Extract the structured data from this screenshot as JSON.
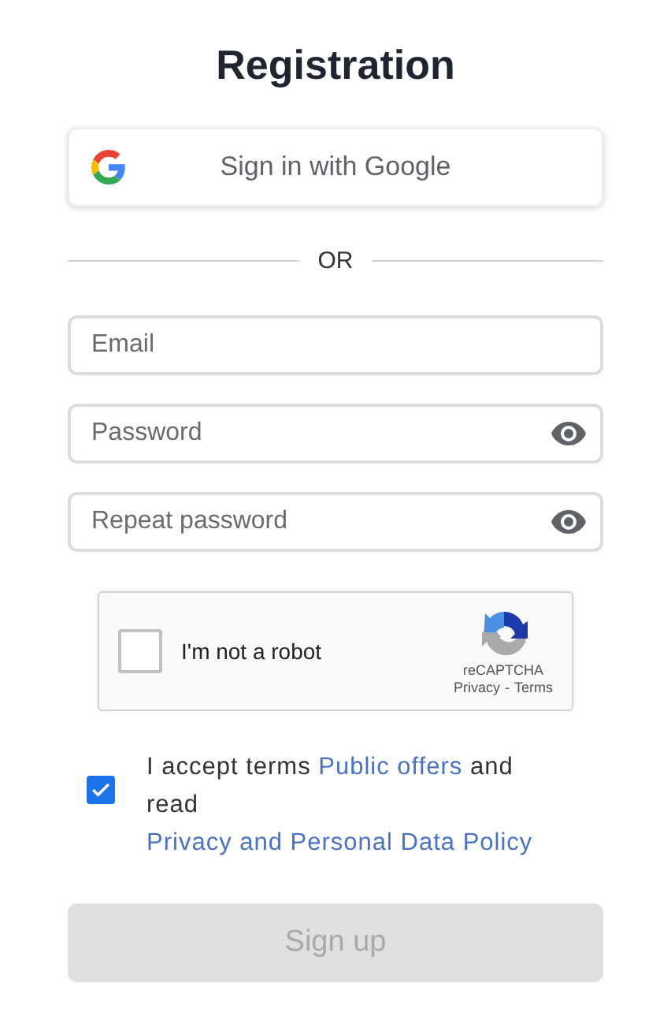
{
  "title": "Registration",
  "google_button": {
    "label": "Sign in with Google"
  },
  "divider": "OR",
  "fields": [
    {
      "placeholder": "Email",
      "kind": "text"
    },
    {
      "placeholder": "Password",
      "kind": "password"
    },
    {
      "placeholder": "Repeat password",
      "kind": "password"
    }
  ],
  "captcha": {
    "label": "I'm not a robot",
    "checked": false,
    "brand": "reCAPTCHA",
    "privacy": "Privacy",
    "separator": "-",
    "terms": "Terms"
  },
  "agreement": {
    "checked": true,
    "parts": [
      {
        "kind": "text",
        "text": "I accept terms "
      },
      {
        "kind": "link",
        "text": "Public offers"
      },
      {
        "kind": "text",
        "text": " and read "
      },
      {
        "kind": "link",
        "text": "Privacy and Personal Data Policy"
      }
    ]
  },
  "submit": {
    "label": "Sign up",
    "disabled": true
  }
}
